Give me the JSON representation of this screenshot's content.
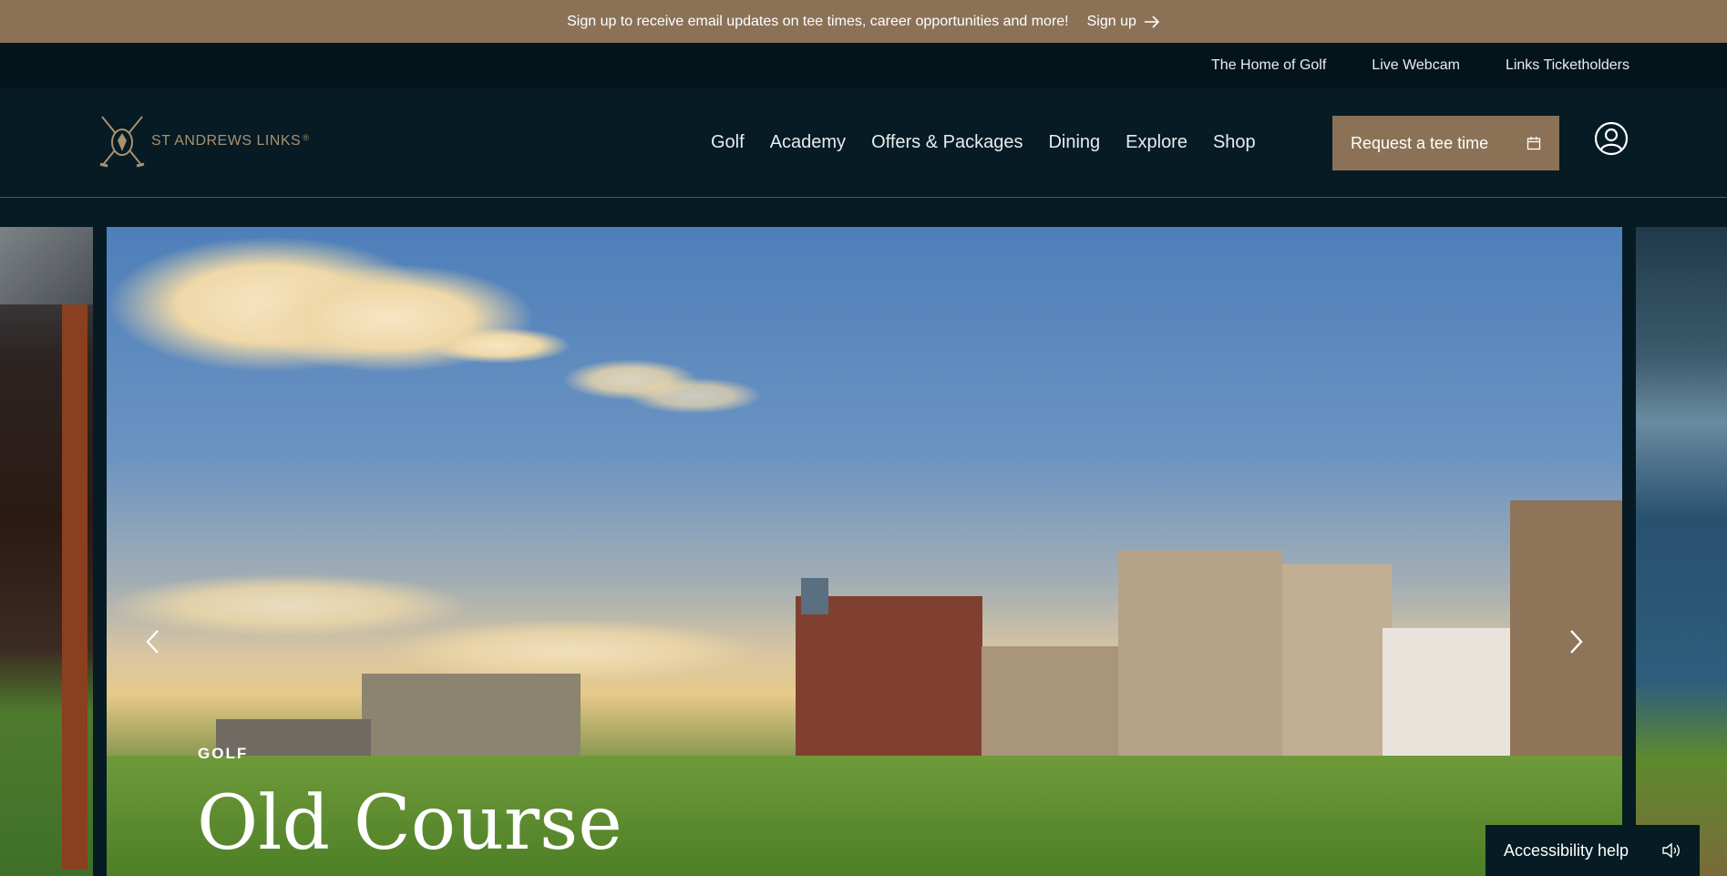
{
  "banner": {
    "message": "Sign up to receive email updates on tee times, career opportunities and more!",
    "signup_label": "Sign up",
    "signup_icon": "arrow-right-icon"
  },
  "utility_nav": {
    "items": [
      "The Home of Golf",
      "Live Webcam",
      "Links Ticketholders"
    ]
  },
  "header": {
    "logo_text": "ST ANDREWS LINKS",
    "logo_mark": "®",
    "nav": [
      "Golf",
      "Academy",
      "Offers & Packages",
      "Dining",
      "Explore",
      "Shop"
    ],
    "cta_label": "Request a tee time",
    "cta_icon": "calendar-icon",
    "account_icon": "user-circle-icon"
  },
  "hero": {
    "eyebrow": "GOLF",
    "title": "Old Course",
    "prev_icon": "chevron-left-icon",
    "next_icon": "chevron-right-icon"
  },
  "accessibility": {
    "label": "Accessibility help",
    "icon": "speaker-icon"
  },
  "colors": {
    "banner": "#8b7257",
    "header_bg": "#061b24",
    "utility_bg": "#04141b",
    "accent": "#8b7257",
    "logo_gold": "#a8916f"
  }
}
